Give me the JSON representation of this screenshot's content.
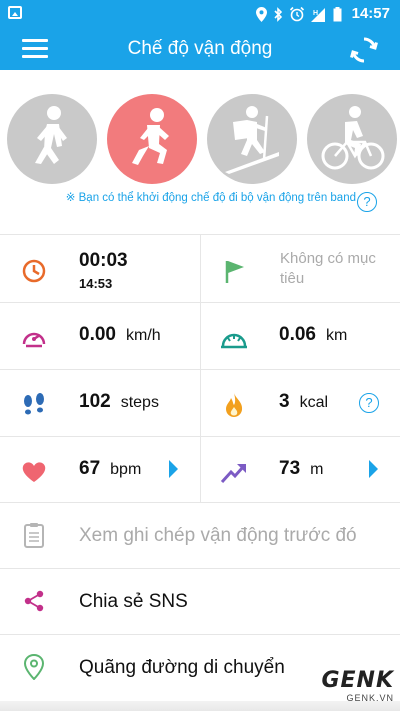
{
  "status_bar": {
    "time": "14:57",
    "network": "H"
  },
  "app_bar": {
    "title": "Chế độ vận động"
  },
  "modes": [
    {
      "name": "walking",
      "active": false
    },
    {
      "name": "running",
      "active": true
    },
    {
      "name": "hiking",
      "active": false
    },
    {
      "name": "cycling",
      "active": false
    }
  ],
  "hint": {
    "text": "※ Bạn có thể khởi động chế độ đi bộ vận động trên band",
    "help": "?"
  },
  "stats": {
    "duration": {
      "value": "00:03",
      "clock": "14:53"
    },
    "goal": {
      "text": "Không có mục tiêu"
    },
    "speed": {
      "value": "0.00",
      "unit": "km/h"
    },
    "distance": {
      "value": "0.06",
      "unit": "km"
    },
    "steps": {
      "value": "102",
      "unit": "steps"
    },
    "calories": {
      "value": "3",
      "unit": "kcal",
      "help": "?"
    },
    "heart_rate": {
      "value": "67",
      "unit": "bpm"
    },
    "altitude": {
      "value": "73",
      "unit": "m"
    }
  },
  "menu": {
    "history": "Xem ghi chép vận động trước đó",
    "share": "Chia sẻ SNS",
    "route": "Quãng đường di chuyển"
  },
  "watermark": {
    "logo": "GENK",
    "site": "GENK.VN"
  },
  "colors": {
    "accent": "#1aa3e8",
    "active_mode": "#f27b7d",
    "inactive_mode": "#c9c9c9"
  }
}
